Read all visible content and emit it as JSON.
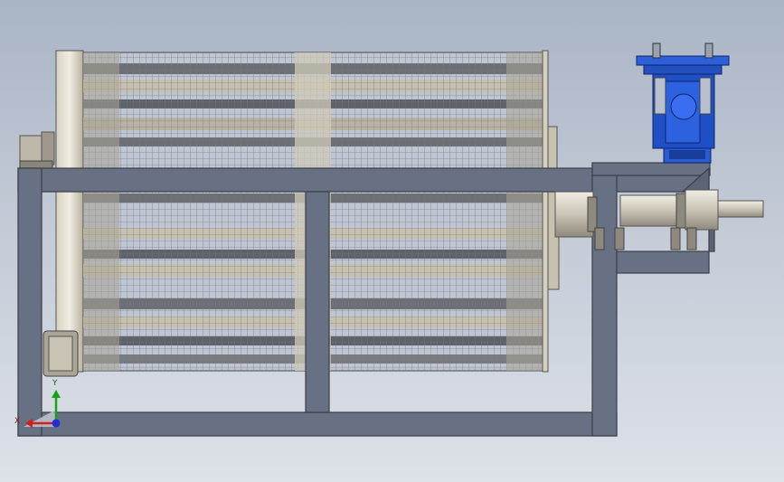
{
  "viewport": {
    "background_top": "#a9b4c5",
    "background_bottom": "#dde1e8"
  },
  "model": {
    "frame_color": "#667081",
    "drum_color": "#b8b4a8",
    "mesh_color": "#7a7f8a",
    "motor_color": "#1f50c8",
    "shaft_color": "#d7d3c6"
  },
  "triad": {
    "x_label": "X",
    "y_label": "Y",
    "x_color": "#d01f1f",
    "y_color": "#19a11b",
    "z_color": "#1f2fd8"
  }
}
